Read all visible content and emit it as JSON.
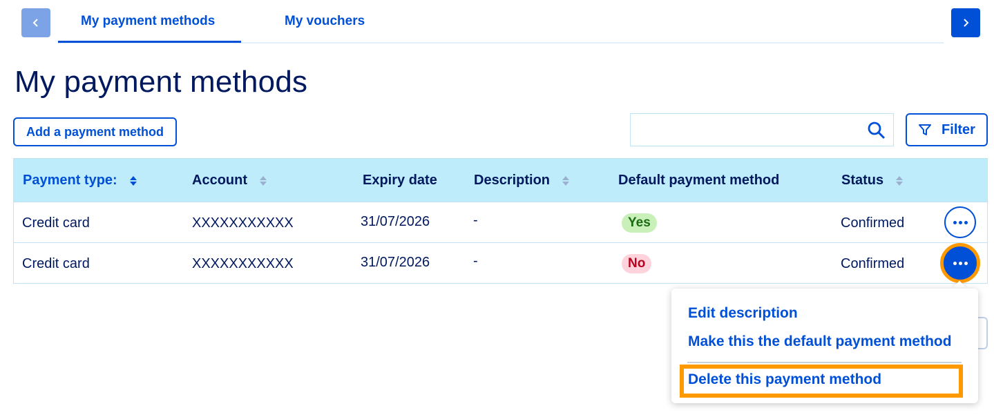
{
  "tabs": {
    "items": [
      {
        "label": "My payment methods",
        "active": true
      },
      {
        "label": "My vouchers",
        "active": false
      }
    ],
    "prev_icon": "chevron-left-icon",
    "next_icon": "chevron-right-icon"
  },
  "page": {
    "title": "My payment methods"
  },
  "toolbar": {
    "add_label": "Add a payment method",
    "search_value": "",
    "search_icon": "search-icon",
    "filter_label": "Filter",
    "filter_icon": "filter-icon"
  },
  "table": {
    "headers": {
      "payment_type": "Payment type:",
      "account": "Account",
      "expiry": "Expiry date",
      "description": "Description",
      "default": "Default payment method",
      "status": "Status"
    },
    "rows": [
      {
        "payment_type": "Credit card",
        "account": "XXXXXXXXXXXX",
        "expiry": "31/07/2026",
        "description": "-",
        "default": "Yes",
        "status": "Confirmed"
      },
      {
        "payment_type": "Credit card",
        "account": "XXXXXXXXXXXX",
        "expiry": "31/07/2026",
        "description": "-",
        "default": "No",
        "status": "Confirmed"
      }
    ]
  },
  "menu": {
    "items": [
      {
        "label": "Edit description"
      },
      {
        "label": "Make this the default payment method"
      },
      {
        "label": "Delete this payment method"
      }
    ]
  },
  "colors": {
    "accent": "#0050d7",
    "highlight": "#ff9900",
    "header_bg": "#bfecfb",
    "text": "#00185e",
    "yes_bg": "#c8f0b8",
    "no_bg": "#ffd3dc"
  }
}
